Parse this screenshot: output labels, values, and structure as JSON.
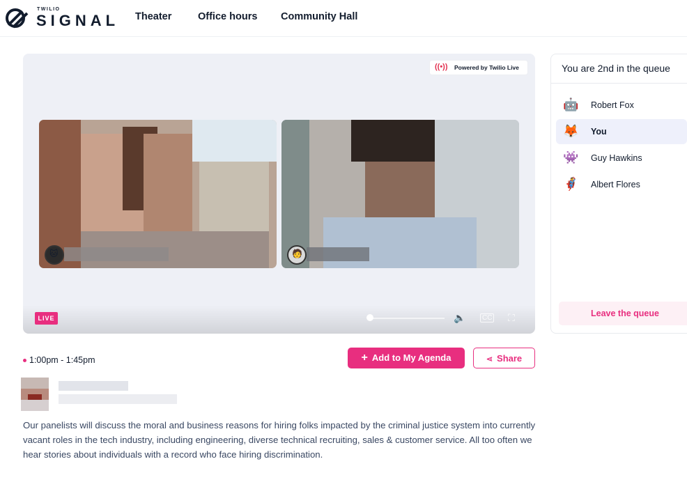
{
  "header": {
    "logo_top": "TWILIO",
    "logo_main": "SIGNAL",
    "nav": [
      {
        "label": "Theater"
      },
      {
        "label": "Office hours"
      },
      {
        "label": "Community Hall"
      }
    ]
  },
  "stage": {
    "powered_by": "Powered by Twilio Live",
    "live_badge": "LIVE",
    "progress": 0.0
  },
  "session": {
    "time": "1:00pm - 1:45pm",
    "add_agenda_label": "Add to My Agenda",
    "share_label": "Share",
    "description": "Our panelists will discuss the moral and business reasons for hiring folks impacted by the criminal justice system into currently vacant roles in the tech industry, including engineering, diverse technical recruiting, sales & customer service. All too often we hear stories about individuals with a record who face hiring discrimination."
  },
  "queue": {
    "title": "You are 2nd in the queue",
    "members": [
      {
        "name": "Robert Fox",
        "active": false
      },
      {
        "name": "You",
        "active": true
      },
      {
        "name": "Guy Hawkins",
        "active": false
      },
      {
        "name": "Albert Flores",
        "active": false
      }
    ],
    "leave_label": "Leave the queue"
  },
  "colors": {
    "accent": "#e82e7f",
    "text": "#121c2d",
    "body_text": "#394762"
  }
}
